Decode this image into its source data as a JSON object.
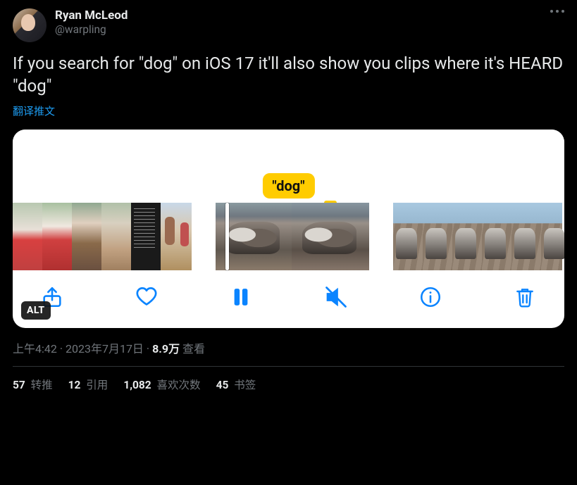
{
  "author": {
    "display_name": "Ryan McLeod",
    "handle": "@warpling"
  },
  "tweet_text": "If you search for \"dog\" on iOS 17 it'll also show you clips where it's HEARD \"dog\"",
  "translate_label": "翻译推文",
  "media": {
    "chip_text": "\"dog\"",
    "alt_label": "ALT",
    "toolbar_icons": [
      "share",
      "heart",
      "pause",
      "mute",
      "info",
      "trash"
    ]
  },
  "meta": {
    "time": "上午4:42",
    "separator": " · ",
    "date": "2023年7月17日",
    "views_number": "8.9万",
    "views_label": " 查看"
  },
  "stats": {
    "retweets": {
      "n": "57",
      "label": " 转推"
    },
    "quotes": {
      "n": "12",
      "label": " 引用"
    },
    "likes": {
      "n": "1,082",
      "label": " 喜欢次数"
    },
    "bookmarks": {
      "n": "45",
      "label": " 书签"
    }
  }
}
